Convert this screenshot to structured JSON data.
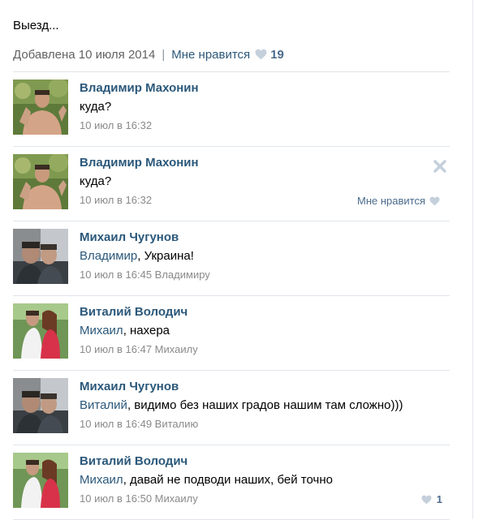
{
  "post": {
    "caption": "Выезд...",
    "added_label": "Добавлена 10 июля 2014",
    "separator": "|",
    "like_label": "Мне нравится",
    "like_count": "19"
  },
  "comments": [
    {
      "author": "Владимир Махонин",
      "mention": "",
      "text": "куда?",
      "date": "10 июл в 16:32",
      "reply_to": "",
      "like_label": "",
      "like_count": ""
    },
    {
      "author": "Владимир Махонин",
      "mention": "",
      "text": "куда?",
      "date": "10 июл в 16:32",
      "reply_to": "",
      "like_label": "Мне нравится",
      "like_count": ""
    },
    {
      "author": "Михаил Чугунов",
      "mention": "Владимир",
      "text": ", Украина!",
      "date": "10 июл в 16:45",
      "reply_to": "Владимиру",
      "like_label": "",
      "like_count": ""
    },
    {
      "author": "Виталий Володич",
      "mention": "Михаил",
      "text": ", нахера",
      "date": "10 июл в 16:47",
      "reply_to": "Михаилу",
      "like_label": "",
      "like_count": ""
    },
    {
      "author": "Михаил Чугунов",
      "mention": "Виталий",
      "text": ", видимо без наших градов нашим там сложно)))",
      "date": "10 июл в 16:49",
      "reply_to": "Виталию",
      "like_label": "",
      "like_count": ""
    },
    {
      "author": "Виталий Володич",
      "mention": "Михаил",
      "text": ", давай не подводи наших, бей точно",
      "date": "10 июл в 16:50",
      "reply_to": "Михаилу",
      "like_label": "",
      "like_count": "1"
    }
  ],
  "colors": {
    "link": "#2b587a",
    "muted": "#8a8a8a",
    "heart": "#c5d0dc"
  }
}
